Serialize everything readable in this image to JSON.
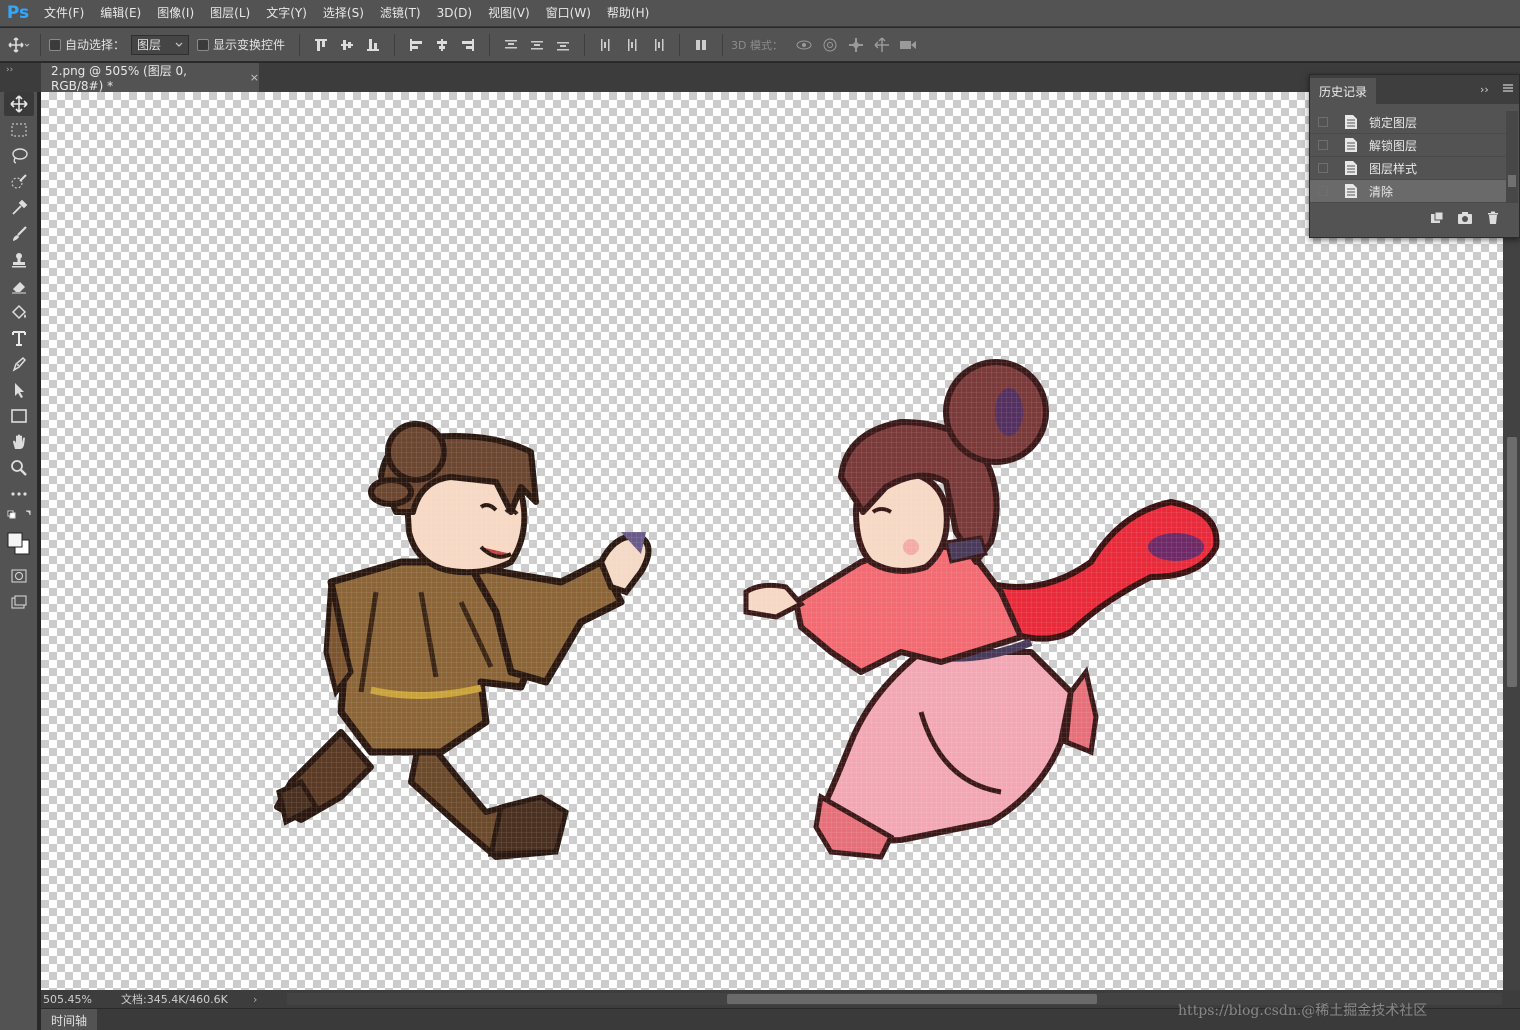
{
  "app": {
    "logo": "Ps"
  },
  "menu": [
    "文件(F)",
    "编辑(E)",
    "图像(I)",
    "图层(L)",
    "文字(Y)",
    "选择(S)",
    "滤镜(T)",
    "3D(D)",
    "视图(V)",
    "窗口(W)",
    "帮助(H)"
  ],
  "options": {
    "auto_select_label": "自动选择：",
    "auto_select_target": "图层",
    "show_transform_label": "显示变换控件",
    "mode_3d_label": "3D 模式："
  },
  "document": {
    "tab_title": "2.png @ 505% (图层 0, RGB/8#) *",
    "close_glyph": "×"
  },
  "status": {
    "zoom": "505.45%",
    "doc_size": "文档:345.4K/460.6K",
    "arrow": "›"
  },
  "timeline": {
    "label": "时间轴"
  },
  "history": {
    "title": "历史记录",
    "collapse_glyph": "››",
    "items": [
      {
        "label": "锁定图层"
      },
      {
        "label": "解锁图层"
      },
      {
        "label": "图层样式"
      },
      {
        "label": "清除",
        "selected": true
      }
    ]
  },
  "watermark": "https://blog.csdn.@稀土掘金技术社区",
  "colors": {
    "ui_dark": "#535353",
    "accent_ps": "#31a8ff",
    "boy_robe": "#8b6538",
    "girl_robe": "#f2a8b4",
    "girl_scarf": "#e82a3a",
    "hair": "#6b4630"
  },
  "tools": [
    "move-icon",
    "marquee-icon",
    "lasso-icon",
    "quick-select-icon",
    "eyedropper-icon",
    "brush-icon",
    "stamp-icon",
    "eraser-icon",
    "paint-bucket-icon",
    "type-icon",
    "pen-icon",
    "path-select-icon",
    "rectangle-icon",
    "hand-icon",
    "zoom-icon",
    "more-tools-icon"
  ]
}
